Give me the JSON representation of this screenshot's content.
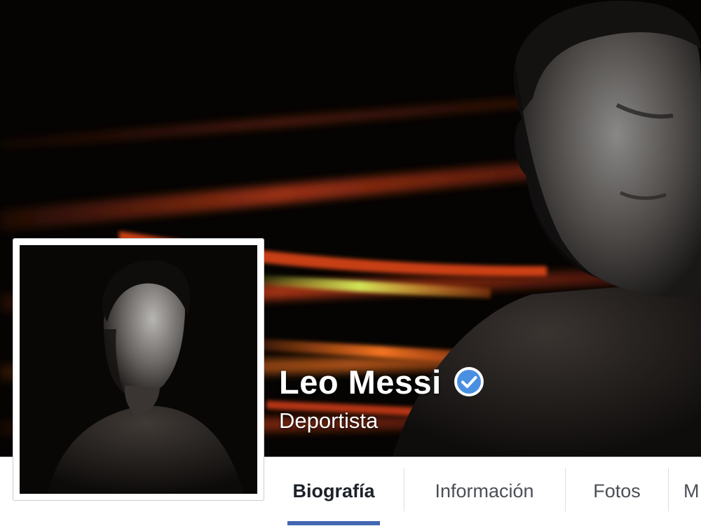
{
  "profile": {
    "name": "Leo Messi",
    "verified": true,
    "category": "Deportista",
    "icons": {
      "verified": "verified-badge-icon"
    }
  },
  "tabs": [
    {
      "label": "Biografía",
      "active": true
    },
    {
      "label": "Información",
      "active": false
    },
    {
      "label": "Fotos",
      "active": false
    },
    {
      "label": "M",
      "active": false
    }
  ],
  "colors": {
    "accent": "#4267b2",
    "verified": "#4a90e2",
    "cover_background": "#050403",
    "light_streak": "#e0421a",
    "tab_text": "#4b4f56"
  }
}
